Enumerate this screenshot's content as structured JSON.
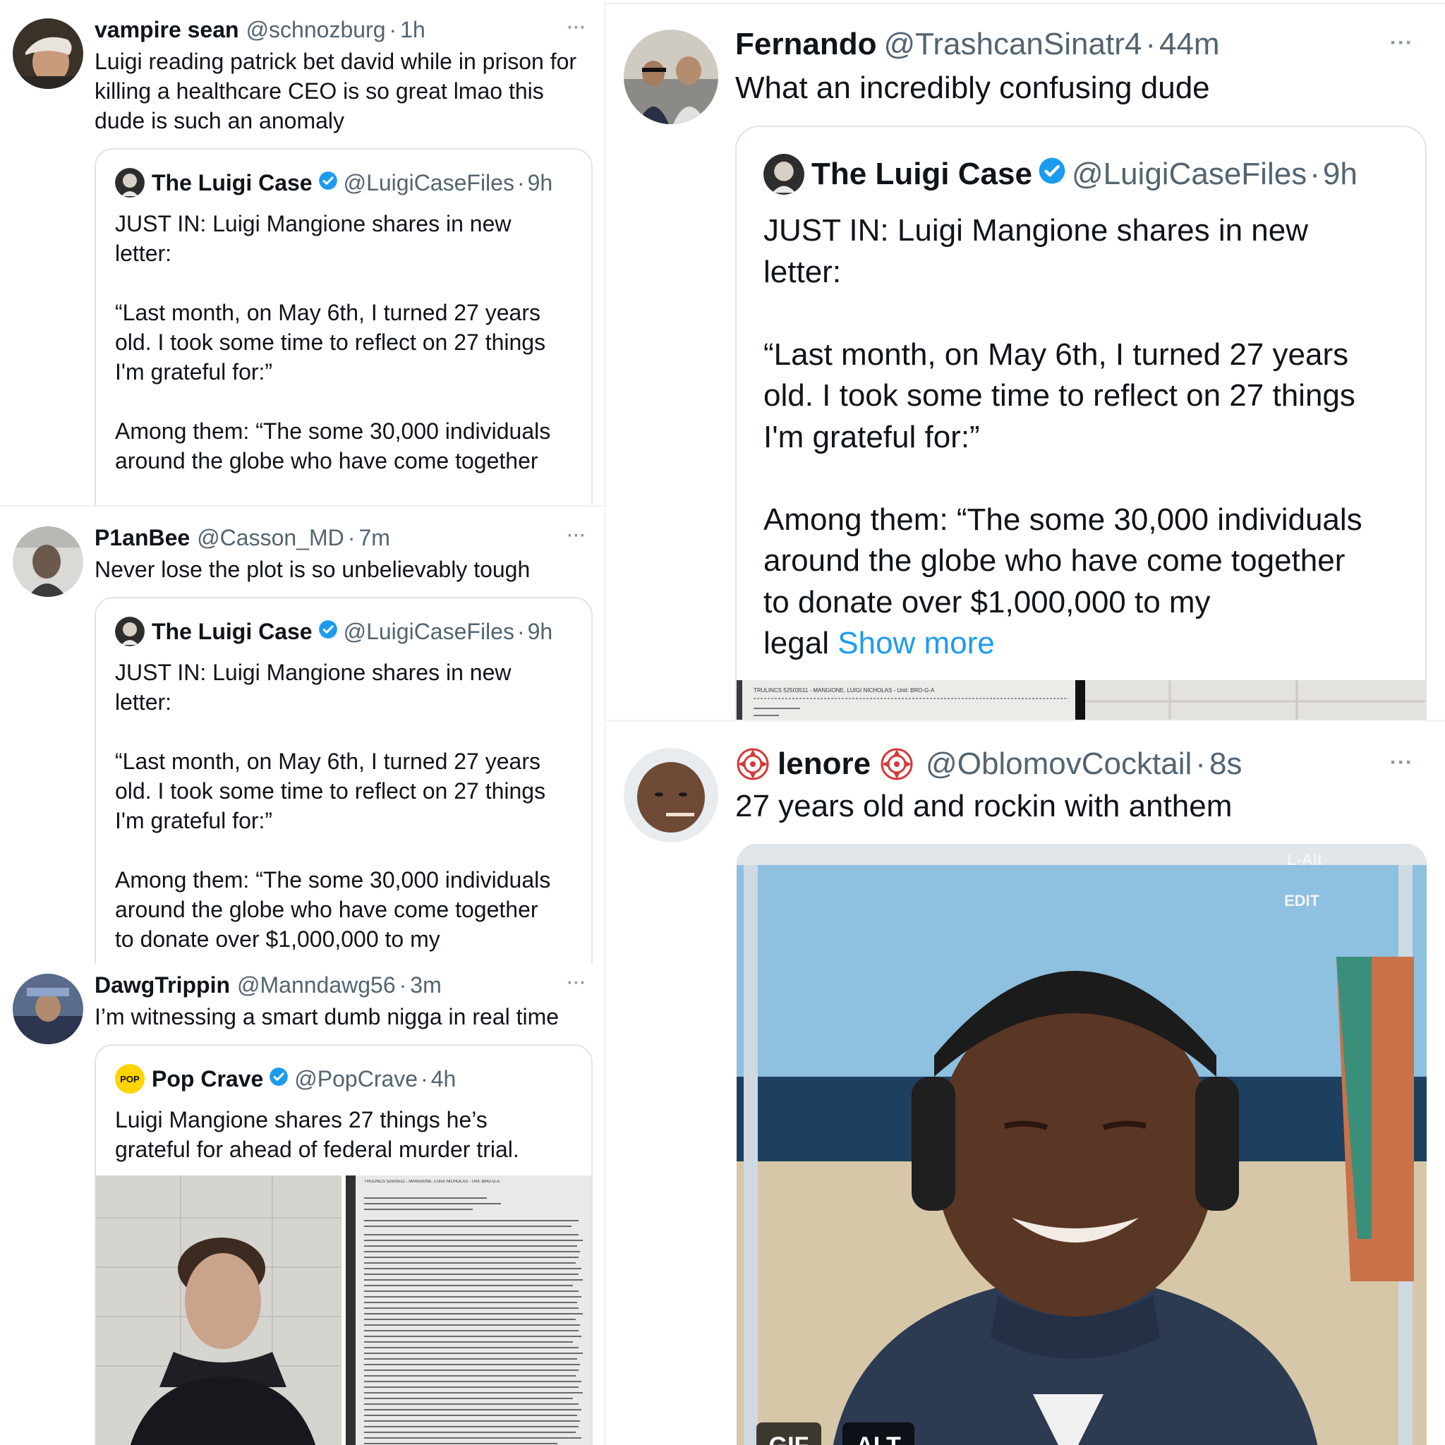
{
  "tweets": {
    "t1": {
      "name": "vampire sean",
      "handle": "@schnozburg",
      "sep": "·",
      "time": "1h",
      "more": "···",
      "text": "Luigi reading patrick bet david while in prison for\nkilling a healthcare CEO is so great lmao this\ndude is such an anomaly",
      "quote": {
        "name": "The Luigi Case",
        "handle": "@LuigiCaseFiles",
        "sep": "·",
        "time": "9h",
        "text": "JUST IN: Luigi Mangione shares in new\nletter:\n\n“Last month, on May 6th, I turned 27 years\nold. I took some time to reflect on 27 things\nI'm grateful for:”\n\nAmong them: “The some 30,000 individuals\naround the globe who have come together"
      }
    },
    "t2": {
      "name": "P1anBee",
      "handle": "@Casson_MD",
      "sep": "·",
      "time": "7m",
      "more": "···",
      "text": "Never lose the plot is so unbelievably tough",
      "quote": {
        "name": "The Luigi Case",
        "handle": "@LuigiCaseFiles",
        "sep": "·",
        "time": "9h",
        "text": "JUST IN: Luigi Mangione shares in new\nletter:\n\n“Last month, on May 6th, I turned 27 years\nold. I took some time to reflect on 27 things\nI'm grateful for:”\n\nAmong them: “The some 30,000 individuals\naround the globe who have come together\nto donate over $1,000,000 to my"
      }
    },
    "t3": {
      "name": "DawgTrippin",
      "handle": "@Manndawg56",
      "sep": "·",
      "time": "3m",
      "more": "···",
      "text": "I’m witnessing a smart dumb nigga in real time",
      "quote": {
        "name": "Pop Crave",
        "handle": "@PopCrave",
        "sep": "·",
        "time": "4h",
        "logo_text": "POP",
        "text": "Luigi Mangione shares 27 things he’s\ngrateful for ahead of federal murder trial.",
        "letter_header": "TRULINCS 52503511 - MANGIONE, LUIGI NICHOLAS - Unit: BRO-G-A"
      }
    },
    "t4": {
      "name": "Fernando",
      "handle": "@TrashcanSinatr4",
      "sep": "·",
      "time": "44m",
      "more": "···",
      "text": "What an incredibly confusing dude",
      "quote": {
        "name": "The Luigi Case",
        "handle": "@LuigiCaseFiles",
        "sep": "·",
        "time": "9h",
        "text": "JUST IN: Luigi Mangione shares in new\nletter:\n\n“Last month, on May 6th, I turned 27 years\nold. I took some time to reflect on 27 things\nI'm grateful for:”\n\nAmong them: “The some 30,000 individuals\naround the globe who have come together\nto donate over $1,000,000 to my\nlegal ",
        "show_more": "Show more",
        "letter_header": "TRULINCS 52503511 - MANGIONE, LUIGI NICHOLAS - Unit: BRO-G-A"
      }
    },
    "t5": {
      "name": "lenore",
      "handle": "@OblomovCocktail",
      "sep": "·",
      "time": "8s",
      "more": "···",
      "text": "27 years old and rockin with anthem",
      "gif_label": "GIF",
      "alt_label": "ALT",
      "sign_top": "L-Alt",
      "sign_bottom": "EDIT"
    }
  },
  "colors": {
    "verified": "#1d9bf0",
    "muted": "#536471",
    "border": "#dfe4e8"
  },
  "icons": [
    "verified-badge-icon",
    "more-options-icon",
    "pop-crave-logo",
    "rose-emoji-icon"
  ]
}
